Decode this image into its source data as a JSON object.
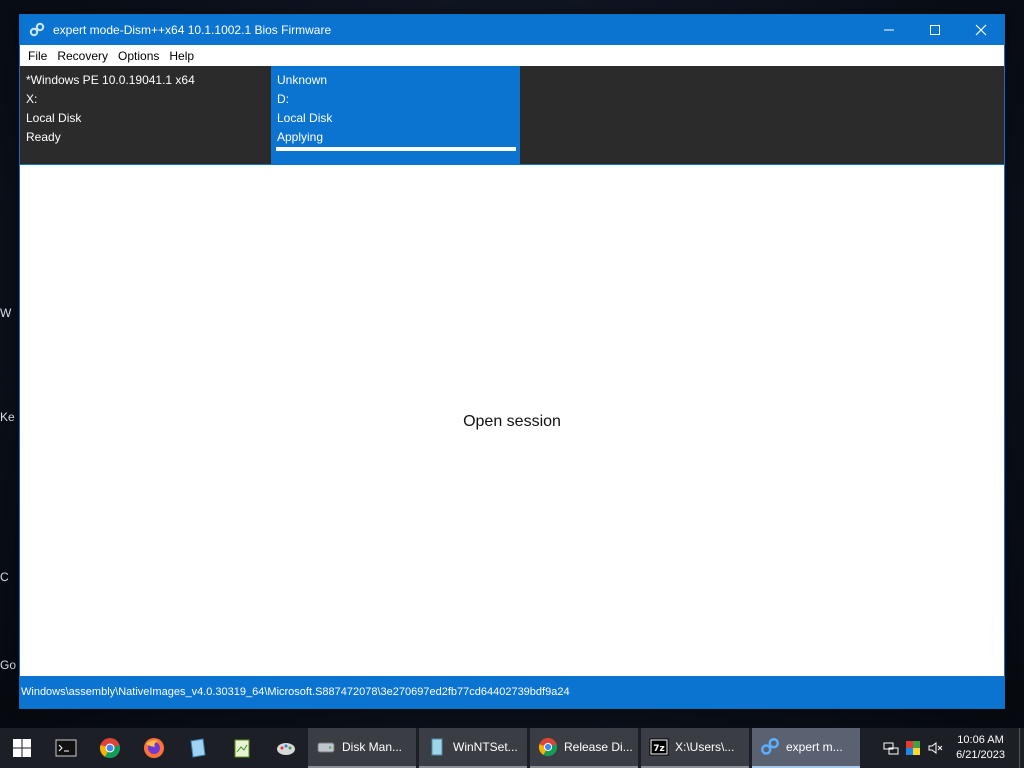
{
  "desktop": {
    "labels": [
      "W",
      "Ke",
      "C",
      "Go"
    ]
  },
  "window": {
    "title": "expert mode-Dism++x64 10.1.1002.1 Bios Firmware",
    "menu": [
      "File",
      "Recovery",
      "Options",
      "Help"
    ],
    "sessions": [
      {
        "lines": [
          "*Windows PE 10.0.19041.1 x64",
          "X:",
          "Local Disk",
          "Ready"
        ],
        "selected": false
      },
      {
        "lines": [
          "Unknown",
          "D:",
          "Local Disk",
          "Applying"
        ],
        "selected": true,
        "progress": 1.0
      }
    ],
    "content_text": "Open session",
    "status_text": "Windows\\assembly\\NativeImages_v4.0.30319_64\\Microsoft.S887472078\\3e270697ed2fb77cd64402739bdf9a24"
  },
  "taskbar": {
    "tasks": [
      {
        "label": "Disk Man...",
        "icon": "disk-icon"
      },
      {
        "label": "WinNTSet...",
        "icon": "setup-icon"
      },
      {
        "label": "Release Di...",
        "icon": "chrome-icon"
      },
      {
        "label": "X:\\Users\\...",
        "icon": "7zip-icon"
      },
      {
        "label": "expert m...",
        "icon": "dism-icon",
        "active": true
      }
    ],
    "clock_time": "10:06 AM",
    "clock_date": "6/21/2023"
  },
  "colors": {
    "accent": "#0b74d1",
    "session_bg": "#2b2b2b"
  }
}
